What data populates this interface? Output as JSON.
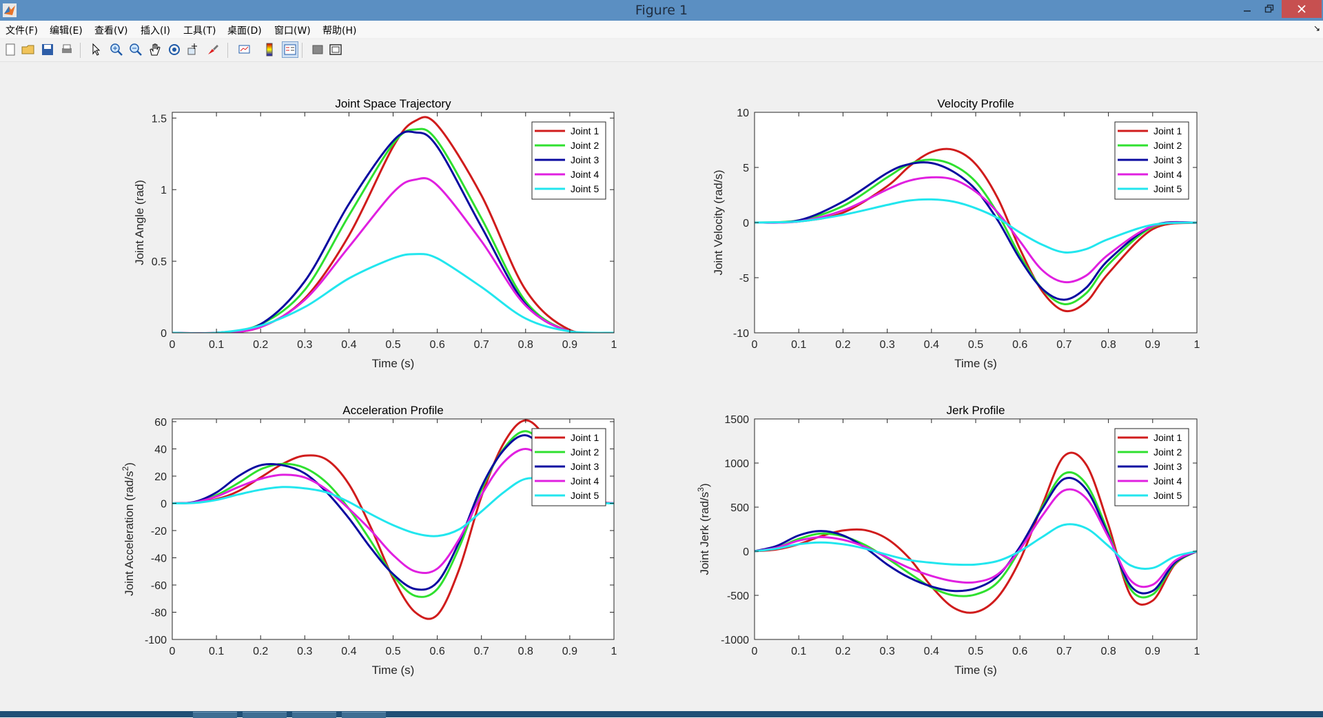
{
  "window": {
    "title": "Figure 1",
    "controls": [
      "minimize",
      "maximize",
      "close"
    ]
  },
  "menu": [
    "文件(F)",
    "编辑(E)",
    "查看(V)",
    "插入(I)",
    "工具(T)",
    "桌面(D)",
    "窗口(W)",
    "帮助(H)"
  ],
  "toolbar": [
    {
      "icon": "new-figure-icon"
    },
    {
      "icon": "open-file-icon"
    },
    {
      "icon": "save-icon"
    },
    {
      "icon": "print-icon"
    },
    {
      "icon": "edit-plot-icon"
    },
    {
      "icon": "zoom-in-icon"
    },
    {
      "icon": "zoom-out-icon"
    },
    {
      "icon": "pan-icon"
    },
    {
      "icon": "rotate-3d-icon"
    },
    {
      "icon": "data-cursor-icon"
    },
    {
      "icon": "brush-icon"
    },
    {
      "icon": "link-plot-icon"
    },
    {
      "icon": "colorbar-icon"
    },
    {
      "icon": "legend-icon",
      "pressed": true
    },
    {
      "icon": "hide-plot-tools-icon"
    },
    {
      "icon": "show-plot-tools-icon"
    }
  ],
  "colors": {
    "Joint 1": "#d01c1c",
    "Joint 2": "#2fe02f",
    "Joint 3": "#0a0aa0",
    "Joint 4": "#e020e0",
    "Joint 5": "#22e6ee"
  },
  "chart_data": [
    {
      "type": "line",
      "title": "Joint Space Trajectory",
      "xlabel": "Time (s)",
      "ylabel": "Joint Angle (rad)",
      "xlim": [
        0,
        1
      ],
      "ylim": [
        0,
        1.54
      ],
      "xticks": [
        0,
        0.1,
        0.2,
        0.3,
        0.4,
        0.5,
        0.6,
        0.7,
        0.8,
        0.9,
        1
      ],
      "yticks": [
        0,
        0.5,
        1,
        1.5
      ],
      "xtick_labels": [
        "0",
        "0.1",
        "0.2",
        "0.3",
        "0.4",
        "0.5",
        "0.6",
        "0.7",
        "0.8",
        "0.9",
        "1"
      ],
      "ytick_labels": [
        "0",
        "0.5",
        "1",
        "1.5"
      ],
      "legend": "top-right",
      "x": [
        0,
        0.1,
        0.2,
        0.3,
        0.4,
        0.5,
        0.55,
        0.6,
        0.7,
        0.8,
        0.9,
        1
      ],
      "series": [
        {
          "name": "Joint 1",
          "values": [
            0,
            0,
            0.04,
            0.24,
            0.68,
            1.3,
            1.48,
            1.45,
            0.96,
            0.3,
            0.02,
            0
          ]
        },
        {
          "name": "Joint 2",
          "values": [
            0,
            0,
            0.06,
            0.3,
            0.82,
            1.32,
            1.42,
            1.34,
            0.8,
            0.22,
            0.01,
            0
          ]
        },
        {
          "name": "Joint 3",
          "values": [
            0,
            0,
            0.06,
            0.36,
            0.9,
            1.34,
            1.4,
            1.3,
            0.74,
            0.2,
            0.01,
            0
          ]
        },
        {
          "name": "Joint 4",
          "values": [
            0,
            0,
            0.04,
            0.23,
            0.6,
            0.98,
            1.07,
            1.03,
            0.64,
            0.19,
            0.01,
            0
          ]
        },
        {
          "name": "Joint 5",
          "values": [
            0,
            0,
            0.05,
            0.18,
            0.38,
            0.52,
            0.55,
            0.52,
            0.32,
            0.1,
            0.01,
            0
          ]
        }
      ]
    },
    {
      "type": "line",
      "title": "Velocity Profile",
      "xlabel": "Time (s)",
      "ylabel": "Joint Velocity (rad/s)",
      "xlim": [
        0,
        1
      ],
      "ylim": [
        -10,
        10
      ],
      "xticks": [
        0,
        0.1,
        0.2,
        0.3,
        0.4,
        0.5,
        0.6,
        0.7,
        0.8,
        0.9,
        1
      ],
      "yticks": [
        -10,
        -5,
        0,
        5,
        10
      ],
      "xtick_labels": [
        "0",
        "0.1",
        "0.2",
        "0.3",
        "0.4",
        "0.5",
        "0.6",
        "0.7",
        "0.8",
        "0.9",
        "1"
      ],
      "ytick_labels": [
        "-10",
        "-5",
        "0",
        "5",
        "10"
      ],
      "legend": "top-right",
      "x": [
        0,
        0.1,
        0.2,
        0.3,
        0.35,
        0.4,
        0.45,
        0.5,
        0.55,
        0.6,
        0.65,
        0.7,
        0.75,
        0.8,
        0.9,
        1
      ],
      "series": [
        {
          "name": "Joint 1",
          "values": [
            0,
            0.1,
            0.9,
            3.3,
            5.1,
            6.4,
            6.6,
            5.3,
            2.2,
            -2.4,
            -6.2,
            -8.0,
            -7.2,
            -4.6,
            -0.6,
            0
          ]
        },
        {
          "name": "Joint 2",
          "values": [
            0,
            0.2,
            1.5,
            4.1,
            5.3,
            5.7,
            5.2,
            3.7,
            0.8,
            -3.0,
            -6.0,
            -7.4,
            -6.4,
            -3.8,
            -0.4,
            0
          ]
        },
        {
          "name": "Joint 3",
          "values": [
            0,
            0.2,
            1.9,
            4.5,
            5.3,
            5.4,
            4.6,
            3.0,
            0.2,
            -3.3,
            -6.0,
            -7.0,
            -5.9,
            -3.4,
            -0.3,
            0
          ]
        },
        {
          "name": "Joint 4",
          "values": [
            0,
            0.1,
            1.1,
            3.0,
            3.8,
            4.1,
            3.9,
            2.8,
            0.9,
            -1.7,
            -4.3,
            -5.4,
            -4.8,
            -2.9,
            -0.3,
            0
          ]
        },
        {
          "name": "Joint 5",
          "values": [
            0,
            0.1,
            0.7,
            1.6,
            2.0,
            2.1,
            1.9,
            1.3,
            0.4,
            -0.9,
            -2.0,
            -2.7,
            -2.4,
            -1.5,
            -0.2,
            0
          ]
        }
      ]
    },
    {
      "type": "line",
      "title": "Acceleration Profile",
      "xlabel": "Time (s)",
      "ylabel": "Joint Acceleration (rad/s",
      "ylabel_sup": "2",
      "ylabel_end": ")",
      "xlim": [
        0,
        1
      ],
      "ylim": [
        -100,
        62
      ],
      "xticks": [
        0,
        0.1,
        0.2,
        0.3,
        0.4,
        0.5,
        0.6,
        0.7,
        0.8,
        0.9,
        1
      ],
      "yticks": [
        -100,
        -80,
        -60,
        -40,
        -20,
        0,
        20,
        40,
        60
      ],
      "xtick_labels": [
        "0",
        "0.1",
        "0.2",
        "0.3",
        "0.4",
        "0.5",
        "0.6",
        "0.7",
        "0.8",
        "0.9",
        "1"
      ],
      "ytick_labels": [
        "-100",
        "-80",
        "-60",
        "-40",
        "-20",
        "0",
        "20",
        "40",
        "60"
      ],
      "legend": "top-right",
      "x": [
        0,
        0.05,
        0.1,
        0.15,
        0.2,
        0.25,
        0.3,
        0.35,
        0.4,
        0.45,
        0.5,
        0.55,
        0.6,
        0.65,
        0.7,
        0.75,
        0.8,
        0.85,
        0.9,
        0.95,
        1
      ],
      "series": [
        {
          "name": "Joint 1",
          "values": [
            0,
            0.5,
            3,
            9,
            19,
            29,
            35,
            32,
            14,
            -18,
            -55,
            -80,
            -82,
            -48,
            5,
            44,
            61,
            46,
            17,
            3,
            0
          ]
        },
        {
          "name": "Joint 2",
          "values": [
            0,
            0.8,
            6,
            15,
            25,
            29,
            26,
            15,
            -4,
            -28,
            -53,
            -68,
            -63,
            -32,
            10,
            40,
            53,
            39,
            14,
            2,
            0
          ]
        },
        {
          "name": "Joint 3",
          "values": [
            0,
            1,
            8,
            20,
            28,
            28,
            22,
            8,
            -11,
            -33,
            -52,
            -63,
            -58,
            -28,
            12,
            39,
            50,
            36,
            13,
            2,
            0
          ]
        },
        {
          "name": "Joint 4",
          "values": [
            0,
            0.7,
            5,
            12,
            18,
            21,
            19,
            10,
            -4,
            -20,
            -38,
            -50,
            -48,
            -26,
            6,
            30,
            40,
            30,
            11,
            2,
            0
          ]
        },
        {
          "name": "Joint 5",
          "values": [
            0,
            0.3,
            2.5,
            6.5,
            10,
            12,
            11,
            8,
            1,
            -8,
            -16,
            -22,
            -24,
            -19,
            -6,
            8,
            18,
            16,
            7,
            1,
            0
          ]
        }
      ]
    },
    {
      "type": "line",
      "title": "Jerk Profile",
      "xlabel": "Time (s)",
      "ylabel": "Joint Jerk (rad/s",
      "ylabel_sup": "3",
      "ylabel_end": ")",
      "xlim": [
        0,
        1
      ],
      "ylim": [
        -1000,
        1500
      ],
      "xticks": [
        0,
        0.1,
        0.2,
        0.3,
        0.4,
        0.5,
        0.6,
        0.7,
        0.8,
        0.9,
        1
      ],
      "yticks": [
        -1000,
        -500,
        0,
        500,
        1000,
        1500
      ],
      "xtick_labels": [
        "0",
        "0.1",
        "0.2",
        "0.3",
        "0.4",
        "0.5",
        "0.6",
        "0.7",
        "0.8",
        "0.9",
        "1"
      ],
      "ytick_labels": [
        "-1000",
        "-500",
        "0",
        "500",
        "1000",
        "1500"
      ],
      "legend": "top-right",
      "x": [
        0,
        0.05,
        0.1,
        0.15,
        0.2,
        0.25,
        0.3,
        0.35,
        0.4,
        0.45,
        0.5,
        0.55,
        0.6,
        0.65,
        0.7,
        0.75,
        0.8,
        0.85,
        0.9,
        0.95,
        1
      ],
      "series": [
        {
          "name": "Joint 1",
          "values": [
            0,
            20,
            80,
            170,
            235,
            240,
            140,
            -80,
            -400,
            -640,
            -690,
            -520,
            -100,
            520,
            1080,
            980,
            300,
            -500,
            -560,
            -150,
            0
          ]
        },
        {
          "name": "Joint 2",
          "values": [
            0,
            40,
            140,
            200,
            170,
            70,
            -80,
            -250,
            -410,
            -500,
            -490,
            -350,
            20,
            500,
            880,
            760,
            210,
            -430,
            -490,
            -140,
            0
          ]
        },
        {
          "name": "Joint 3",
          "values": [
            0,
            60,
            180,
            230,
            180,
            40,
            -150,
            -300,
            -400,
            -450,
            -420,
            -280,
            50,
            480,
            820,
            700,
            180,
            -390,
            -450,
            -130,
            0
          ]
        },
        {
          "name": "Joint 4",
          "values": [
            0,
            40,
            120,
            160,
            130,
            50,
            -70,
            -190,
            -280,
            -340,
            -350,
            -260,
            20,
            400,
            690,
            600,
            160,
            -330,
            -380,
            -110,
            0
          ]
        },
        {
          "name": "Joint 5",
          "values": [
            0,
            30,
            80,
            100,
            80,
            30,
            -40,
            -100,
            -130,
            -150,
            -150,
            -110,
            0,
            160,
            300,
            260,
            60,
            -160,
            -190,
            -60,
            0
          ]
        }
      ]
    }
  ]
}
